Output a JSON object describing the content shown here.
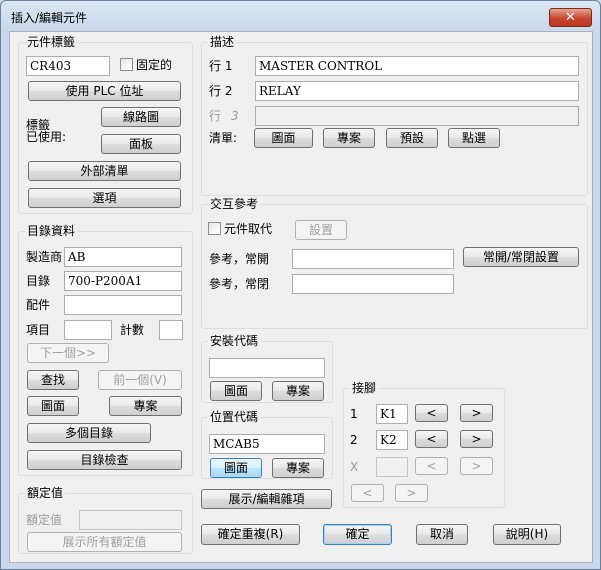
{
  "window": {
    "title": "插入/編輯元件",
    "close": "✕"
  },
  "component_tag": {
    "group": "元件標籤",
    "tag_value": "CR403",
    "fixed_label": "固定的",
    "use_plc_button": "使用 PLC 位址",
    "tags_used_label_1": "標籤",
    "tags_used_label_2": "已使用:",
    "schematic_button": "線路圖",
    "panel_button": "面板",
    "external_list_button": "外部清單",
    "options_button": "選項"
  },
  "description": {
    "group": "描述",
    "line1_label": "行  1",
    "line1_value": "MASTER CONTROL",
    "line2_label": "行  2",
    "line2_value": "RELAY",
    "line3_label_a": "行",
    "line3_label_b": "3",
    "line3_value": "",
    "list_label": "清單:",
    "drawing_button": "圖面",
    "project_button": "專案",
    "defaults_button": "預設",
    "pick_button": "點選"
  },
  "catalog": {
    "group": "目錄資料",
    "manufacturer_label": "製造商",
    "manufacturer_value": "AB",
    "catalog_label": "目錄",
    "catalog_value": "700-P200A1",
    "assembly_label": "配件",
    "assembly_value": "",
    "item_label": "項目",
    "item_value": "",
    "count_label": "計數",
    "count_value": "",
    "next_button": "下一個>>",
    "lookup_button": "查找",
    "previous_button": "前一個(V)",
    "drawing_button": "圖面",
    "project_button": "專案",
    "multiple_catalog_button": "多個目錄",
    "catalog_check_button": "目錄檢查"
  },
  "ratings": {
    "group": "額定值",
    "rating_label": "額定值",
    "rating_value": "",
    "show_all_button": "展示所有額定值"
  },
  "cross_reference": {
    "group": "交互參考",
    "override_label": "元件取代",
    "setup_button": "設置",
    "ref_no_label": "參考，常開",
    "ref_no_value": "",
    "ref_nc_label": "參考，常閉",
    "ref_nc_value": "",
    "no_nc_setup_button": "常開/常閉設置"
  },
  "installation": {
    "group": "安裝代碼",
    "value": "",
    "drawing_button": "圖面",
    "project_button": "專案"
  },
  "location": {
    "group": "位置代碼",
    "value": "MCAB5",
    "drawing_button": "圖面",
    "project_button": "專案"
  },
  "show_edit_misc_button": "展示/編輯雜項",
  "pins": {
    "group": "接腳",
    "row1_label": "1",
    "row1_value": "K1",
    "row2_label": "2",
    "row2_value": "K2",
    "row3_label": "X",
    "row3_value": "",
    "left_arrow": "<",
    "right_arrow": ">"
  },
  "footer": {
    "ok_repeat_button": "確定重複(R)",
    "ok_button": "確定",
    "cancel_button": "取消",
    "help_button": "說明(H)"
  }
}
